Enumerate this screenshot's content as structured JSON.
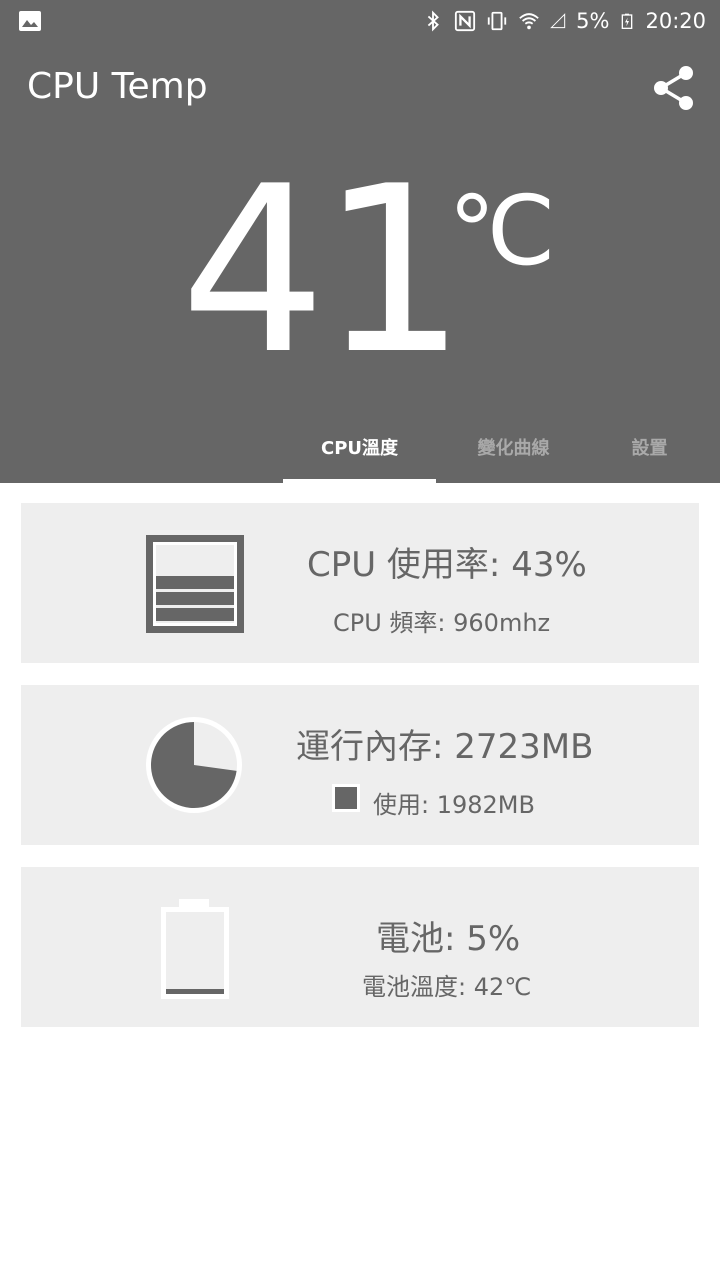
{
  "status_bar": {
    "battery_percent": "5%",
    "time": "20:20",
    "icons": [
      "image-icon",
      "bluetooth-icon",
      "nfc-icon",
      "vibrate-icon",
      "wifi-icon",
      "signal-icon",
      "battery-charging-icon"
    ]
  },
  "app": {
    "title": "CPU Temp",
    "share_icon": "share-icon"
  },
  "temperature": {
    "value": "41",
    "unit": "℃"
  },
  "tabs": [
    {
      "label": "CPU溫度",
      "active": true
    },
    {
      "label": "變化曲線",
      "active": false
    },
    {
      "label": "設置",
      "active": false
    }
  ],
  "cards": {
    "cpu": {
      "icon": "cpu-usage-icon",
      "main": "CPU 使用率: 43%",
      "sub": "CPU 頻率: 960mhz",
      "usage_fraction": 0.43
    },
    "memory": {
      "icon": "memory-pie-icon",
      "main": "運行內存: 2723MB",
      "sub": "使用: 1982MB",
      "used_fraction": 0.728
    },
    "battery": {
      "icon": "battery-icon",
      "main": "電池: 5%",
      "sub": "電池溫度: 42℃",
      "level_fraction": 0.05
    }
  },
  "colors": {
    "header_bg": "#666666",
    "card_bg": "#eeeeee",
    "text": "#666666",
    "inactive_tab": "#a9a9a9"
  }
}
